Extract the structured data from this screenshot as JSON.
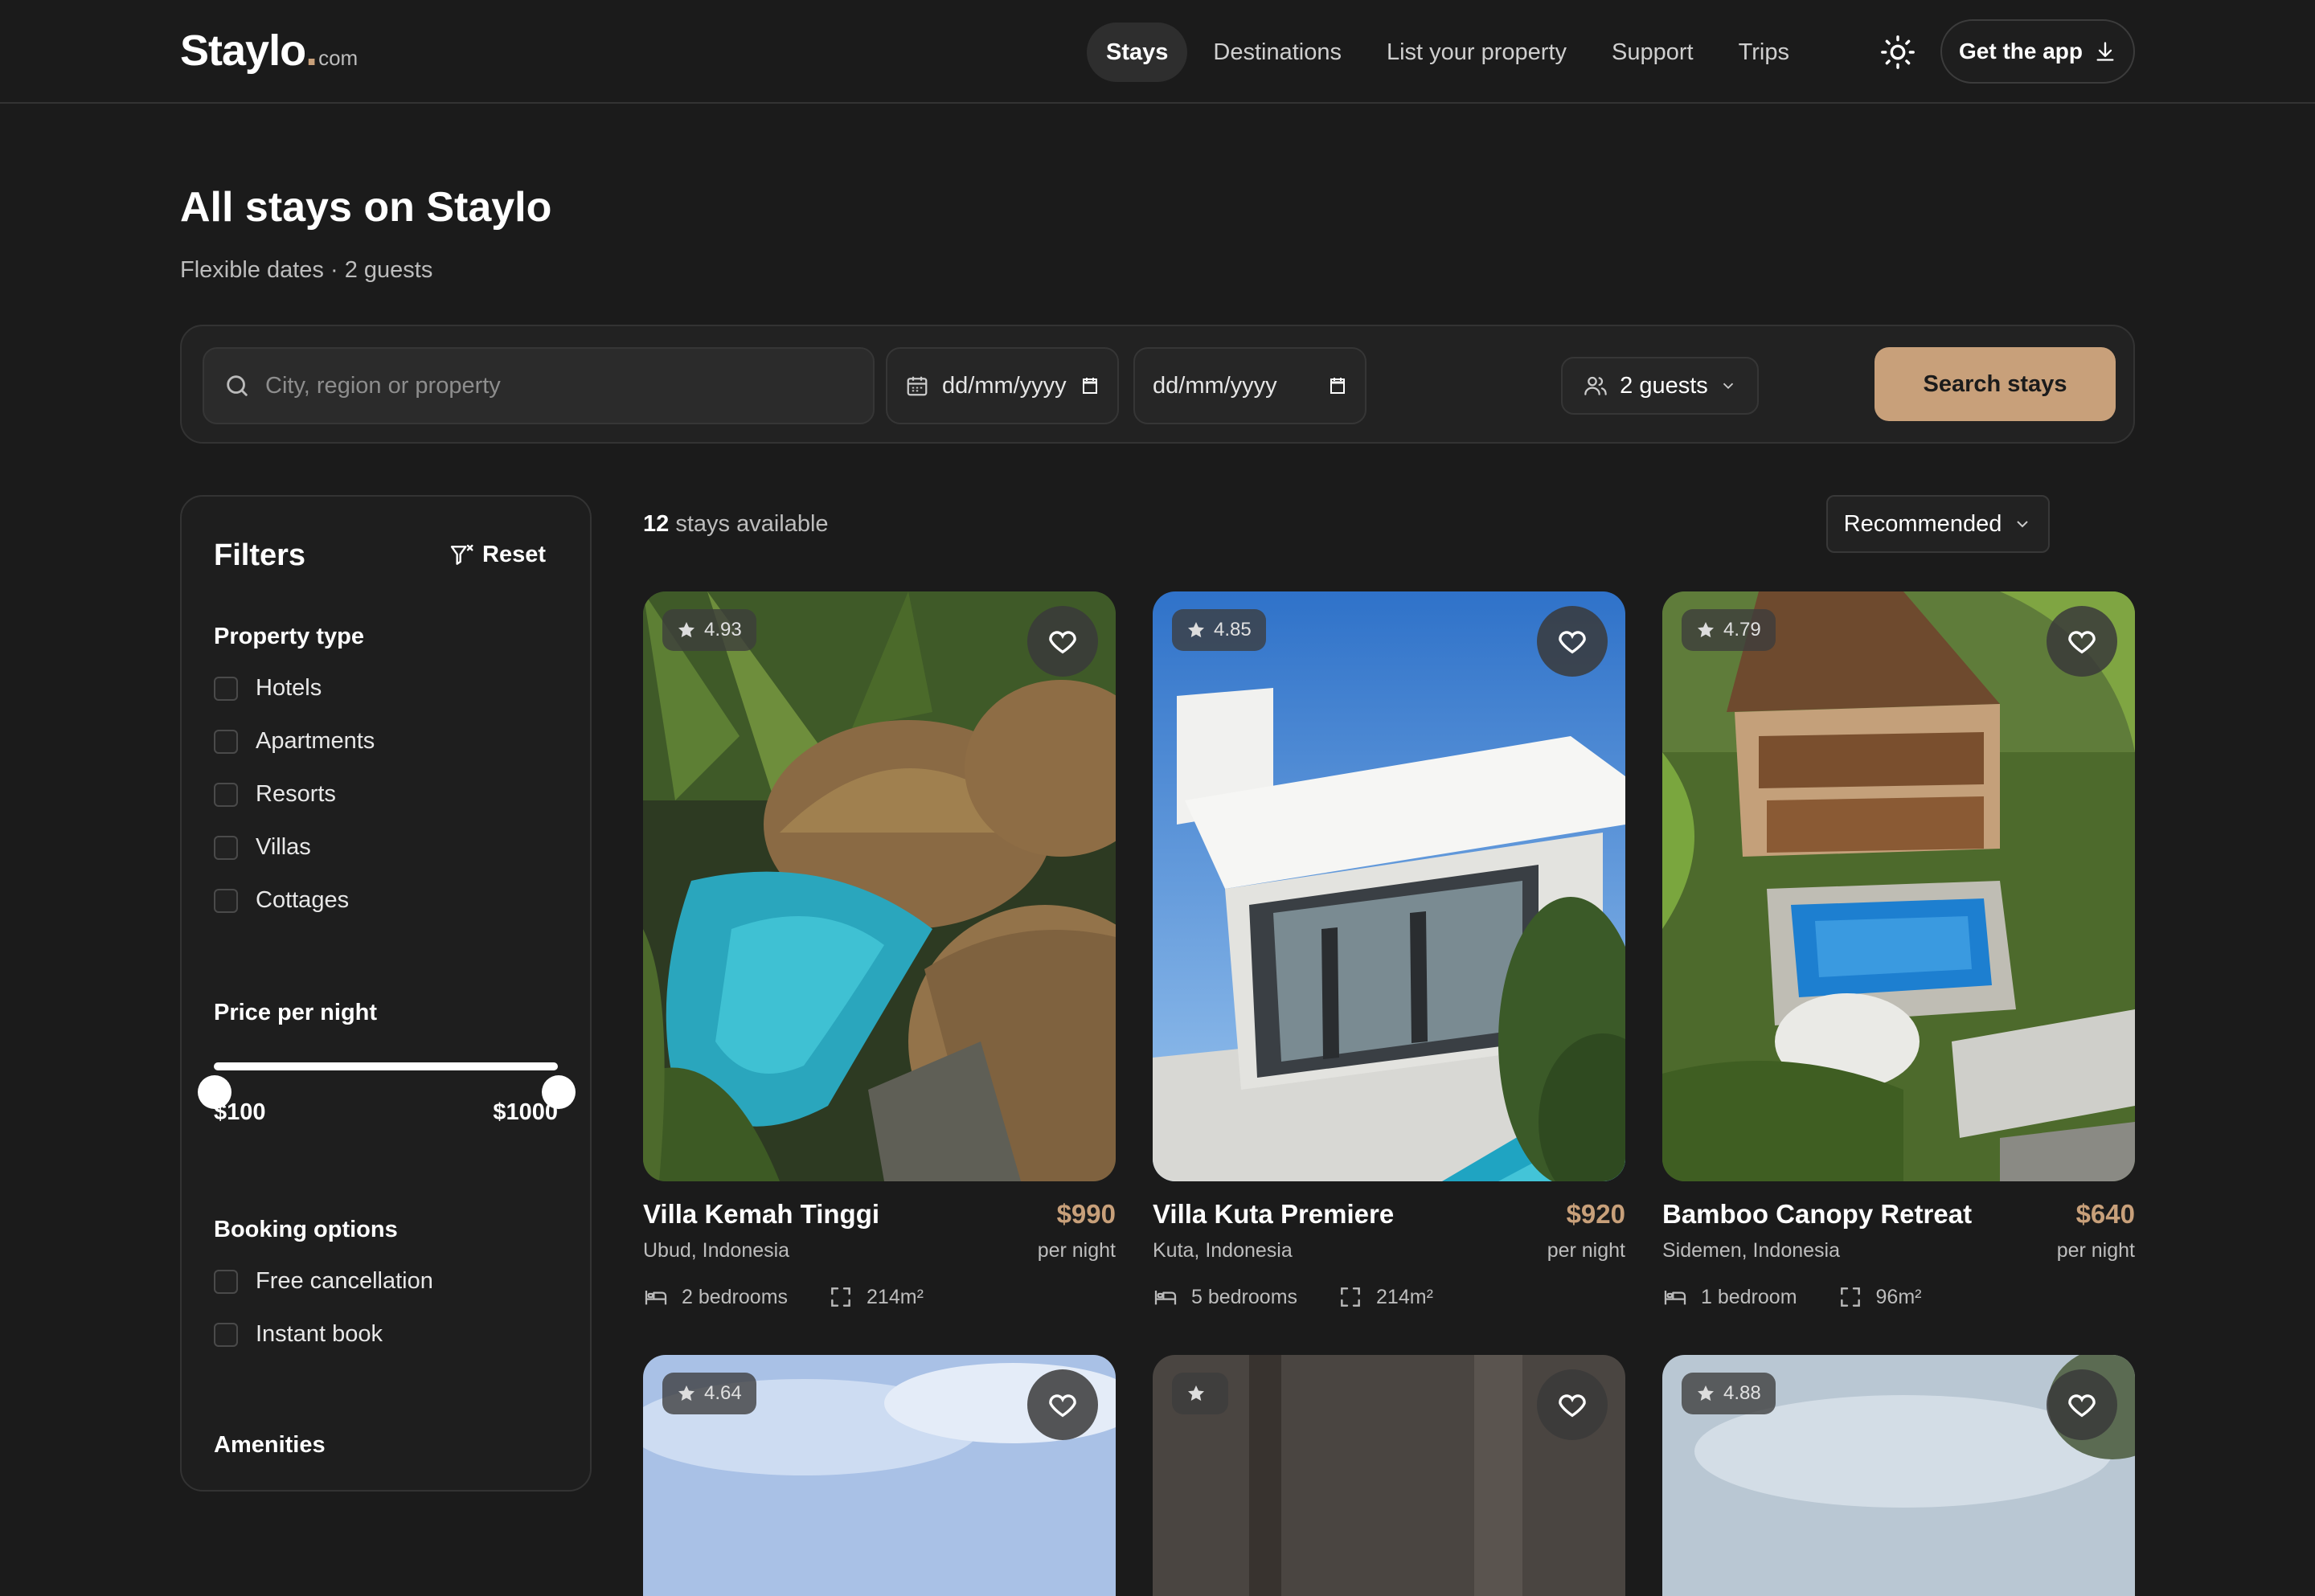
{
  "header": {
    "logo_name": "Staylo",
    "logo_dot": ".",
    "logo_tld": "com",
    "nav": [
      "Stays",
      "Destinations",
      "List your property",
      "Support",
      "Trips"
    ],
    "get_app": "Get the app"
  },
  "page": {
    "title": "All stays on Staylo",
    "subtitle": "Flexible dates · 2 guests"
  },
  "search": {
    "placeholder": "City, region or property",
    "checkin_value": "dd/mm/yyyy",
    "checkout_value": "dd/mm/yyyy",
    "guests": "2 guests",
    "button": "Search stays"
  },
  "filters": {
    "title": "Filters",
    "reset": "Reset",
    "property_type": {
      "heading": "Property type",
      "options": [
        "Hotels",
        "Apartments",
        "Resorts",
        "Villas",
        "Cottages"
      ]
    },
    "price": {
      "heading": "Price per night",
      "min_label": "$100",
      "max_label": "$1000"
    },
    "booking": {
      "heading": "Booking options",
      "options": [
        "Free cancellation",
        "Instant book"
      ]
    },
    "amenities_heading": "Amenities"
  },
  "results": {
    "count": "12",
    "count_suffix": "stays available",
    "sort": "Recommended"
  },
  "cards": [
    {
      "rating": "4.93",
      "name": "Villa Kemah Tinggi",
      "location": "Ubud, Indonesia",
      "price": "$990",
      "per": "per night",
      "bedrooms": "2 bedrooms",
      "area": "214m²"
    },
    {
      "rating": "4.85",
      "name": "Villa Kuta Premiere",
      "location": "Kuta, Indonesia",
      "price": "$920",
      "per": "per night",
      "bedrooms": "5 bedrooms",
      "area": "214m²"
    },
    {
      "rating": "4.79",
      "name": "Bamboo Canopy Retreat",
      "location": "Sidemen, Indonesia",
      "price": "$640",
      "per": "per night",
      "bedrooms": "1 bedroom",
      "area": "96m²"
    },
    {
      "rating": "4.64"
    },
    {
      "rating": ""
    },
    {
      "rating": "4.88"
    }
  ],
  "colors": {
    "background": "#1b1b1b",
    "accent": "#c8a07a",
    "text": "#ececec"
  }
}
